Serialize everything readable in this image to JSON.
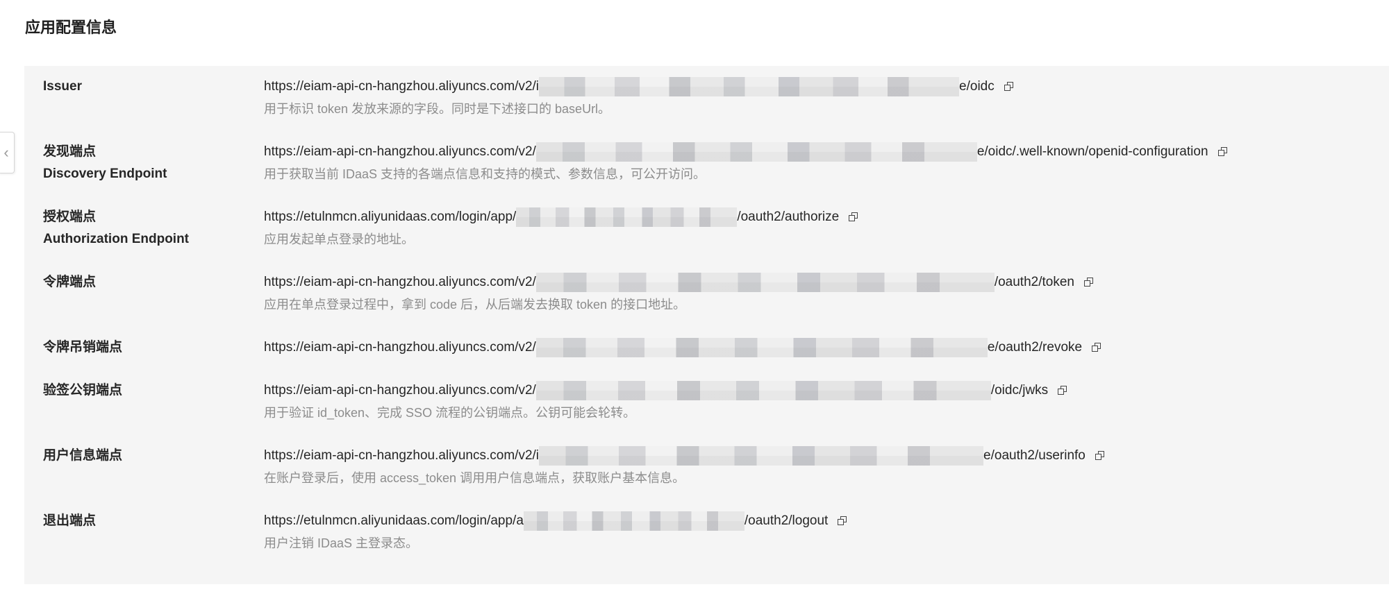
{
  "section_title": "应用配置信息",
  "collapse_glyph": "‹",
  "rows": [
    {
      "label": "Issuer",
      "label_en": "",
      "url_prefix": "https://eiam-api-cn-hangzhou.aliyuncs.com/v2/i",
      "url_suffix": "e/oidc",
      "description": "用于标识 token 发放来源的字段。同时是下述接口的 baseUrl。"
    },
    {
      "label": "发现端点",
      "label_en": "Discovery Endpoint",
      "url_prefix": "https://eiam-api-cn-hangzhou.aliyuncs.com/v2/",
      "url_suffix": "e/oidc/.well-known/openid-configuration",
      "description": "用于获取当前 IDaaS 支持的各端点信息和支持的模式、参数信息，可公开访问。"
    },
    {
      "label": "授权端点",
      "label_en": "Authorization Endpoint",
      "url_prefix": "https://etulnmcn.aliyunidaas.com/login/app/",
      "url_suffix": "/oauth2/authorize",
      "description": "应用发起单点登录的地址。"
    },
    {
      "label": "令牌端点",
      "label_en": "",
      "url_prefix": "https://eiam-api-cn-hangzhou.aliyuncs.com/v2/",
      "url_suffix": "/oauth2/token",
      "description": "应用在单点登录过程中，拿到 code 后，从后端发去换取 token 的接口地址。"
    },
    {
      "label": "令牌吊销端点",
      "label_en": "",
      "url_prefix": "https://eiam-api-cn-hangzhou.aliyuncs.com/v2/",
      "url_suffix": "e/oauth2/revoke",
      "description": ""
    },
    {
      "label": "验签公钥端点",
      "label_en": "",
      "url_prefix": "https://eiam-api-cn-hangzhou.aliyuncs.com/v2/",
      "url_suffix": "/oidc/jwks",
      "description": "用于验证 id_token、完成 SSO 流程的公钥端点。公钥可能会轮转。"
    },
    {
      "label": "用户信息端点",
      "label_en": "",
      "url_prefix": "https://eiam-api-cn-hangzhou.aliyuncs.com/v2/i",
      "url_suffix": "e/oauth2/userinfo",
      "description": "在账户登录后，使用 access_token 调用用户信息端点，获取账户基本信息。"
    },
    {
      "label": "退出端点",
      "label_en": "",
      "url_prefix": "https://etulnmcn.aliyunidaas.com/login/app/a",
      "url_suffix": "/oauth2/logout",
      "description": "用户注销 IDaaS 主登录态。"
    }
  ]
}
